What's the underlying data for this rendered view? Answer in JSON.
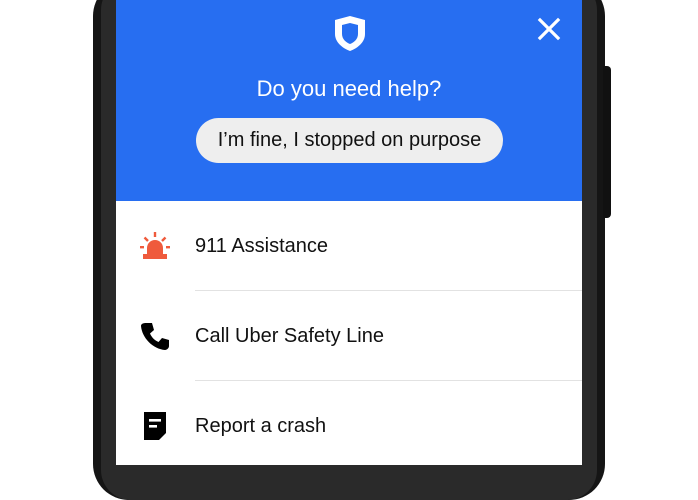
{
  "header": {
    "title": "Do you need help?",
    "fine_button_label": "I’m fine, I stopped on purpose",
    "background_color": "#276ef1",
    "shield_icon": "shield-icon",
    "close_icon": "close-icon"
  },
  "options": [
    {
      "label": "911 Assistance",
      "icon": "siren-icon",
      "icon_color": "#ef5a3c"
    },
    {
      "label": "Call Uber Safety Line",
      "icon": "phone-icon",
      "icon_color": "#000000"
    },
    {
      "label": "Report a crash",
      "icon": "document-icon",
      "icon_color": "#000000"
    }
  ]
}
